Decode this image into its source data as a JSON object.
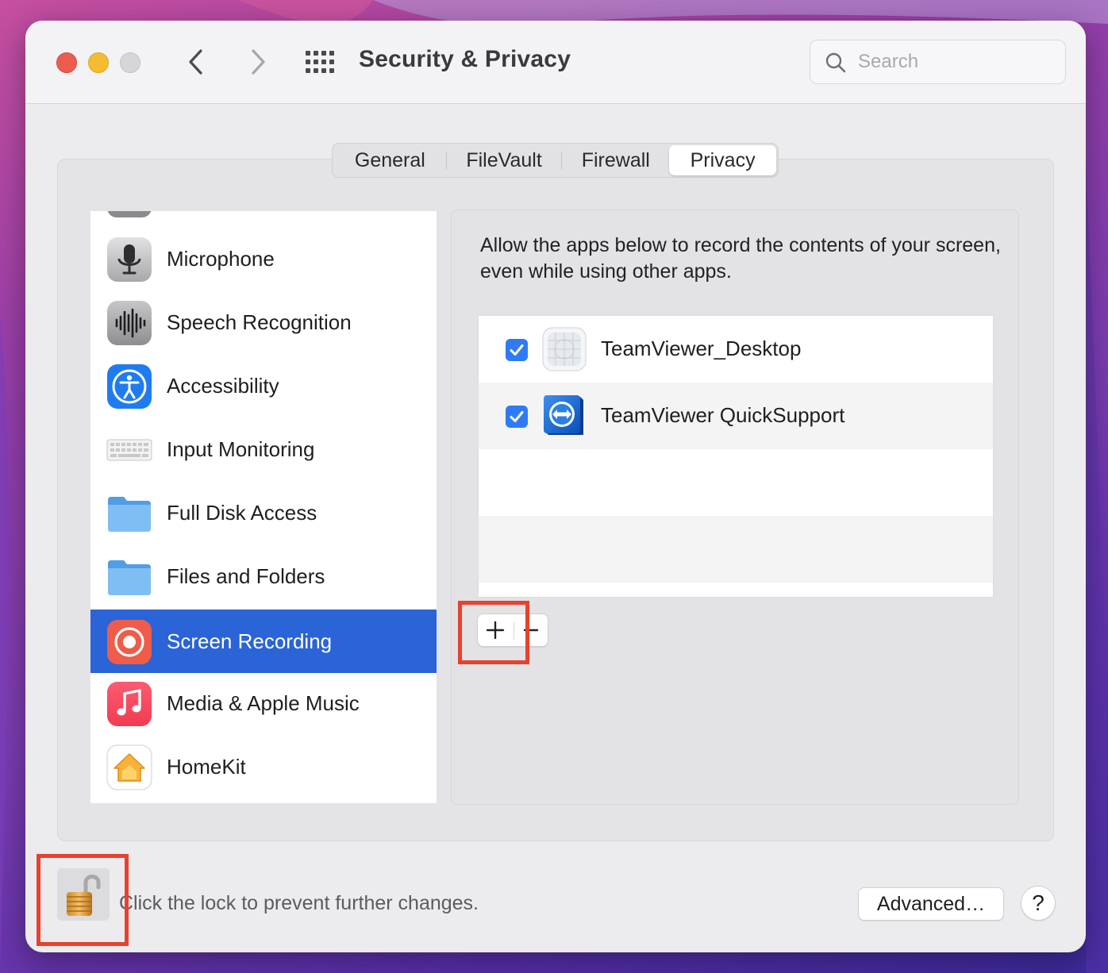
{
  "window": {
    "title": "Security & Privacy"
  },
  "search": {
    "placeholder": "Search"
  },
  "tabs": [
    {
      "label": "General"
    },
    {
      "label": "FileVault"
    },
    {
      "label": "Firewall"
    },
    {
      "label": "Privacy",
      "selected": true
    }
  ],
  "sidebar": {
    "items": [
      {
        "label": "Microphone",
        "icon": "microphone-icon"
      },
      {
        "label": "Speech Recognition",
        "icon": "waveform-icon"
      },
      {
        "label": "Accessibility",
        "icon": "accessibility-icon"
      },
      {
        "label": "Input Monitoring",
        "icon": "keyboard-icon"
      },
      {
        "label": "Full Disk Access",
        "icon": "folder-icon"
      },
      {
        "label": "Files and Folders",
        "icon": "folder-icon"
      },
      {
        "label": "Screen Recording",
        "icon": "screen-recording-icon",
        "selected": true
      },
      {
        "label": "Media & Apple Music",
        "icon": "music-note-icon"
      },
      {
        "label": "HomeKit",
        "icon": "home-icon"
      }
    ]
  },
  "main": {
    "description": "Allow the apps below to record the contents of your screen, even while using other apps.",
    "apps": [
      {
        "name": "TeamViewer_Desktop",
        "checked": true,
        "icon": "teamviewer-desktop-icon"
      },
      {
        "name": "TeamViewer QuickSupport",
        "checked": true,
        "icon": "teamviewer-quicksupport-icon"
      }
    ],
    "add_label": "+",
    "remove_label": "−"
  },
  "footer": {
    "lock_message": "Click the lock to prevent further changes.",
    "advanced_label": "Advanced…",
    "help_label": "?"
  },
  "colors": {
    "selection": "#2a64d6",
    "checkbox": "#2f7bf5",
    "highlight_box": "#e8412f"
  }
}
